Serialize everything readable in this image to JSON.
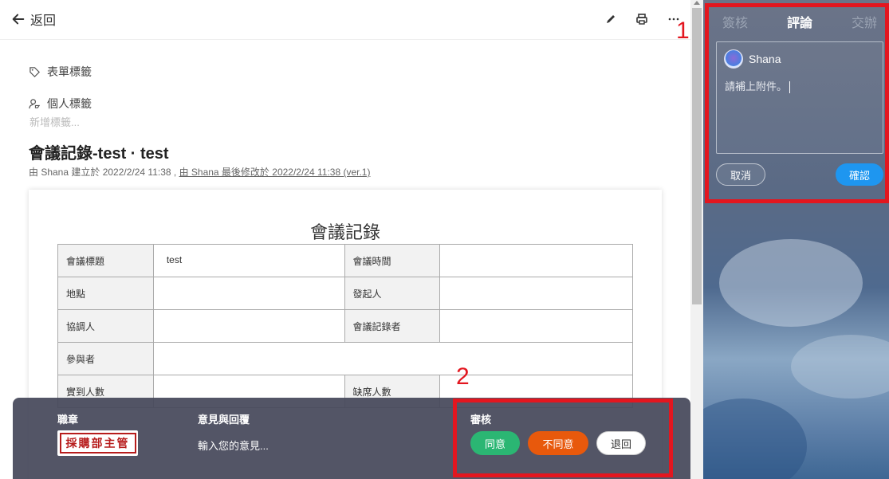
{
  "topbar": {
    "back_label": "返回"
  },
  "tags": {
    "form_tag": "表單標籤",
    "personal_tag": "個人標籤",
    "add_placeholder": "新增標籤..."
  },
  "document": {
    "title": "會議記錄-test · test",
    "meta_created": "由 Shana 建立於 2022/2/24 11:38 , ",
    "meta_modified": "由 Shana 最後修改於 2022/2/24 11:38  (ver.1)",
    "paper_title": "會議記錄",
    "rows": [
      {
        "l1": "會議標題",
        "v1": "test",
        "l2": "會議時間",
        "v2": ""
      },
      {
        "l1": "地點",
        "v1": "",
        "l2": "發起人",
        "v2": ""
      },
      {
        "l1": "協調人",
        "v1": "",
        "l2": "會議記錄者",
        "v2": ""
      },
      {
        "l1": "參與者",
        "v1": ""
      },
      {
        "l1": "實到人數",
        "v1": "",
        "l2": "缺席人數",
        "v2": ""
      }
    ]
  },
  "approval_bar": {
    "stamp_header": "職章",
    "stamp_text": "採購部主管",
    "opinion_header": "意見與回覆",
    "opinion_placeholder": "輸入您的意見...",
    "review_header": "審核",
    "agree": "同意",
    "disagree": "不同意",
    "return": "退回"
  },
  "right_panel": {
    "tabs": [
      "簽核",
      "評論",
      "交辦"
    ],
    "active_tab": "評論",
    "user": "Shana",
    "comment_text": "請補上附件。",
    "cancel": "取消",
    "confirm": "確認"
  },
  "annotations": {
    "one": "1",
    "two": "2"
  },
  "colors": {
    "agree": "#2bb673",
    "disagree": "#e8590c",
    "confirm": "#1e96f0",
    "annotation": "#e3161f"
  }
}
